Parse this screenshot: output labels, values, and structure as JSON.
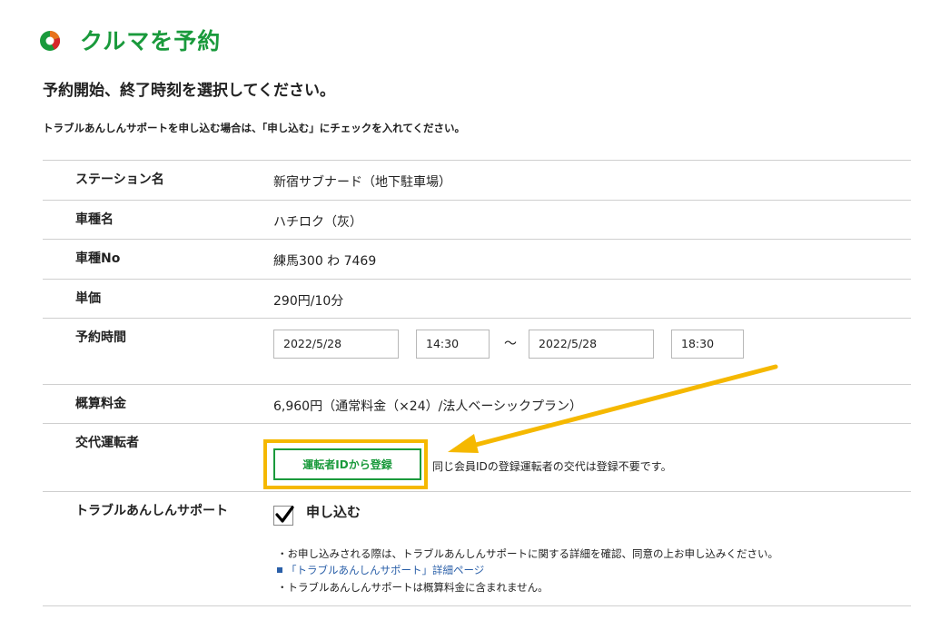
{
  "header": {
    "title": "クルマを予約",
    "logo_icon": "car-share-logo-icon"
  },
  "subtitle": "予約開始、終了時刻を選択してください。",
  "notice": "トラブルあんしんサポートを申し込む場合は、「申し込む」にチェックを入れてください。",
  "form": {
    "station": {
      "label": "ステーション名",
      "value": "新宿サブナード（地下駐車場）"
    },
    "car_name": {
      "label": "車種名",
      "value": "ハチロク（灰）"
    },
    "car_no": {
      "label": "車種No",
      "value": "練馬300 わ 7469"
    },
    "unit_price": {
      "label": "単価",
      "value": "290円/10分"
    },
    "reserve_time": {
      "label": "予約時間",
      "start_date": "2022/5/28",
      "start_time": "14:30",
      "separator": "～",
      "end_date": "2022/5/28",
      "end_time": "18:30"
    },
    "estimated_fee": {
      "label": "概算料金",
      "value": "6,960円（通常料金（×24）/法人ベーシックプラン）"
    },
    "alt_driver": {
      "label": "交代運転者",
      "button": "運転者IDから登録",
      "note": "同じ会員IDの登録運転者の交代は登録不要です。"
    },
    "support": {
      "label": "トラブルあんしんサポート",
      "checkbox_label": "申し込む",
      "checked": true,
      "note_1": "・お申し込みされる際は、トラブルあんしんサポートに関する詳細を確認、同意の上お申し込みください。",
      "link": "「トラブルあんしんサポート」詳細ページ",
      "note_3": "・トラブルあんしんサポートは概算料金に含まれません。"
    }
  },
  "colors": {
    "brand_green": "#1a9a3c",
    "highlight": "#f5b800",
    "link_blue": "#2a5fa8"
  }
}
